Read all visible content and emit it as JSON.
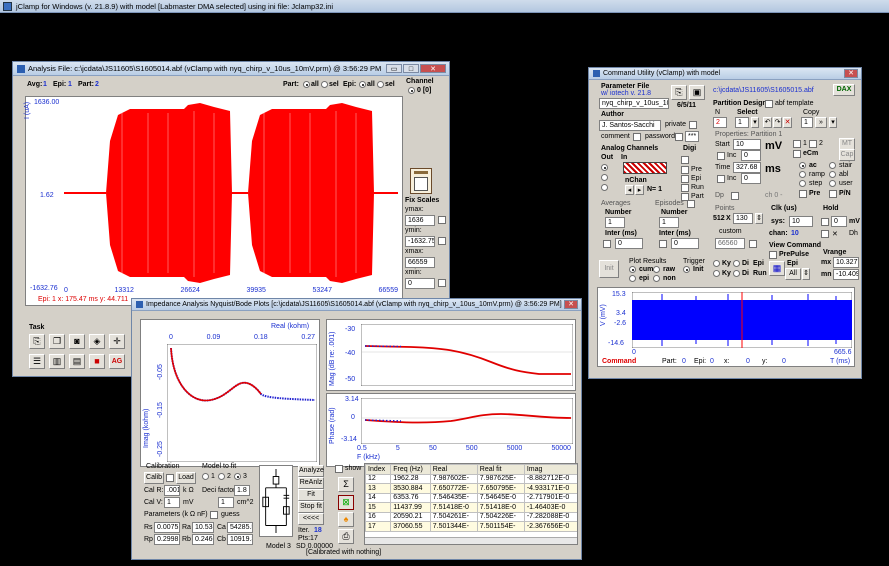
{
  "app_title": "jClamp for Windows (v. 21.8.9) with model [Labmaster DMA selected] using ini file: Jclamp32.ini",
  "analysis": {
    "title": "Analysis  File: c:\\jcdata\\JS11605\\S1605014.abf (vClamp with nyq_chirp_v_10us_10mV.prm) @ 3:56:29 PM",
    "avg_label": "Avg:",
    "avg": "1",
    "epi_label": "Epi:",
    "epi": "1",
    "part_label": "Part:",
    "part": "2",
    "part_radio": "Part:",
    "all": "all",
    "sel": "sel",
    "epi_radio": "Epi:",
    "channel_label": "Channel",
    "channel_value": "0 [0]",
    "y_top": "1636.00",
    "y_mid": "1.62",
    "y_bot": "-1632.76",
    "y_unit": "I (uA)",
    "x_ticks": [
      "0",
      "13312",
      "26624",
      "39935",
      "53247",
      "66559"
    ],
    "status": "Epi: 1  x: 175.47 ms   y: 44.711",
    "fix_scales": "Fix Scales",
    "ymax_label": "ymax:",
    "ymax": "1636",
    "ymin_label": "ymin:",
    "ymin": "-1632.75",
    "xmax_label": "xmax:",
    "xmax": "66559",
    "xmin_label": "xmin:",
    "xmin": "0",
    "task_label": "Task"
  },
  "impedance": {
    "title": "Impedance Analysis Nyquist/Bode Plots   [c:\\jcdata\\JS11605\\S1605014.abf (vClamp with nyq_chirp_v_10us_10mV.prm) @ 3:56:29 PM]",
    "real_label": "Real (kohm)",
    "real_ticks": [
      "0",
      "0.09",
      "0.18",
      "0.27"
    ],
    "imag_label": "Imag (kohm)",
    "imag_ticks": [
      "-0.05",
      "-0.15",
      "-0.25"
    ],
    "mag_label": "Mag (dB re: .001)",
    "mag_ticks": [
      "-30",
      "-40",
      "-50"
    ],
    "phase_label": "Phase (rad)",
    "phase_ticks": [
      "3.14",
      "0",
      "-3.14"
    ],
    "f_label": "F (kHz)",
    "f_ticks": [
      "0.5",
      "5",
      "50",
      "500",
      "5000",
      "50000"
    ],
    "calibration": "Calibration",
    "calib": "Calib",
    "load": "Load",
    "calr_label": "Cal R:",
    "calr": ".001",
    "calr_unit": "k Ω",
    "calv_label": "Cal V:",
    "calv": "1",
    "calv_unit": "mV",
    "model_to_fit": "Model to fit",
    "m1": "1",
    "m2": "2",
    "m3": "3",
    "deci_label": "Deci factor:",
    "deci": "1.8",
    "area": "1",
    "area_unit": "cm^2",
    "params_label": "Parameters (k  Ω  nF)",
    "guess": "guess",
    "rs_label": "Rs",
    "rs": "0.0075",
    "ra_label": "Ra",
    "ra": "10.5359",
    "ca_label": "Ca",
    "ca": "54285.5",
    "rp_label": "Rp",
    "rp": "0.2998",
    "rb_label": "Rb",
    "rb": "0.2466",
    "cb_label": "Cb",
    "cb": "10919.3",
    "analyze": "Analyze",
    "reanlz": "ReAnlz",
    "fit": "Fit",
    "stopfit": "Stop fit",
    "back": "<<<<",
    "iter_label": "Iter.",
    "iter": "18",
    "pts": "Pts:17",
    "model": "Model  3",
    "sd": "SD 0.00000",
    "show": "show",
    "table_headers": [
      "Index",
      "Freq (Hz)",
      "Real",
      "Real fit",
      "Imag"
    ],
    "rows": [
      [
        "12",
        "1962.28",
        "7.987602E-",
        "7.987625E-",
        "-8.882712E-0"
      ],
      [
        "13",
        "3530.884",
        "7.650772E-",
        "7.650795E-",
        "-4.933171E-0"
      ],
      [
        "14",
        "6353.76",
        "7.546435E-",
        "7.54645E-0",
        "-2.717901E-0"
      ],
      [
        "15",
        "11437.99",
        "7.51418E-0",
        "7.51418E-0",
        "-1.46403E-0"
      ],
      [
        "16",
        "20590.21",
        "7.504261E-",
        "7.504226E-",
        "-7.282088E-0"
      ],
      [
        "17",
        "37060.55",
        "7.501344E-",
        "7.501154E-",
        "-2.367656E-0"
      ]
    ],
    "status": "[Calibrated with nothing]"
  },
  "command": {
    "title": "Command Utility (vClamp) with model",
    "param_file": "Parameter File",
    "w_iotech": "w/ iotech  v. 21.8",
    "prm_name": "nyq_chirp_v_10us_10m",
    "date": "6/5/11",
    "path": "c:\\jcdata\\JS11605\\S1605015.abf",
    "dax": "DAX",
    "partition_design": "Partition Design",
    "abf_template": "abf template",
    "n_label": "N",
    "n": "2",
    "select_label": "Select",
    "select": "1",
    "copy_label": "Copy",
    "copy": "1",
    "author_label": "Author",
    "author": "J. Santos-Sacchi",
    "private": "private",
    "comment": "comment",
    "password": "password",
    "stars": "***",
    "props": "Properties: Partition 1",
    "start_label": "Start",
    "start": "10",
    "mv": "mV",
    "inc_label": "Inc",
    "inc": "0",
    "time_label": "Time",
    "time": "327.68",
    "ms": "ms",
    "inc2": "0",
    "r1": "1",
    "r2": "2",
    "ecm": "eCm",
    "mt": "MT",
    "cap": "Cap",
    "ac": "ac",
    "stair": "stair",
    "ramp": "ramp",
    "abl": "abl",
    "step": "step",
    "user": "user",
    "pre": "Pre",
    "pn": "P/N",
    "analog_ch": "Analog Channels",
    "out": "Out",
    "in": "In",
    "digi": "Digi",
    "nchan": "nChan",
    "n1": "N= 1",
    "dpre": "Pre",
    "depi": "Epi",
    "drun": "Run",
    "dpart": "Part",
    "dp_label": "Dp",
    "ch0": "ch 0 -",
    "averages": "Averages",
    "number": "Number",
    "avg_num": "1",
    "inter": "Inter (ms)",
    "avg_inter": "0",
    "episodes": "Episodes",
    "epi_num": "1",
    "epi_inter": "0",
    "points": "Points",
    "pts1": "512",
    "pts_x": "X",
    "pts2": "130",
    "custom": "custom",
    "custom_val": "66560",
    "clk": "Clk (us)",
    "sys_label": "sys:",
    "sys": "10",
    "chan_label": "chan:",
    "chan": "10",
    "hold": "Hold",
    "hold_val": "0",
    "hold_unit": "mV",
    "dh": "Dh",
    "view_cmd": "View Command",
    "prepulse": "PrePulse",
    "epi_lbl": "Epi",
    "all": "All",
    "vrange": "Vrange",
    "mx_label": "mx",
    "mx": "10.3277",
    "mn_label": "mn",
    "mn": "-10.409",
    "init": "Init",
    "plot_results": "Plot Results",
    "cum": "cum",
    "raw": "raw",
    "epi": "epi",
    "non": "non",
    "trigger": "Trigger",
    "ky": "Ky",
    "di": "Di",
    "tepi": "Epi",
    "tinit": "Init",
    "trun": "Run",
    "y_unit": "V (mV)",
    "y_ticks": [
      "15.3",
      "3.4",
      "-2.6",
      "-14.6"
    ],
    "x_ticks": [
      "0",
      "665.6"
    ],
    "x_unit": "T (ms)",
    "footer_command": "Command",
    "footer_part": "Part:",
    "footer_part_v": "0",
    "footer_epi": "Epi:",
    "footer_epi_v": "0",
    "footer_x": "x:",
    "footer_x_v": "0",
    "footer_y": "y:",
    "footer_y_v": "0"
  },
  "colors": {
    "trace_red": "#ff0000",
    "trace_blue": "#0000ff",
    "fit_red": "#e00000",
    "data_blue": "#2020d0"
  }
}
